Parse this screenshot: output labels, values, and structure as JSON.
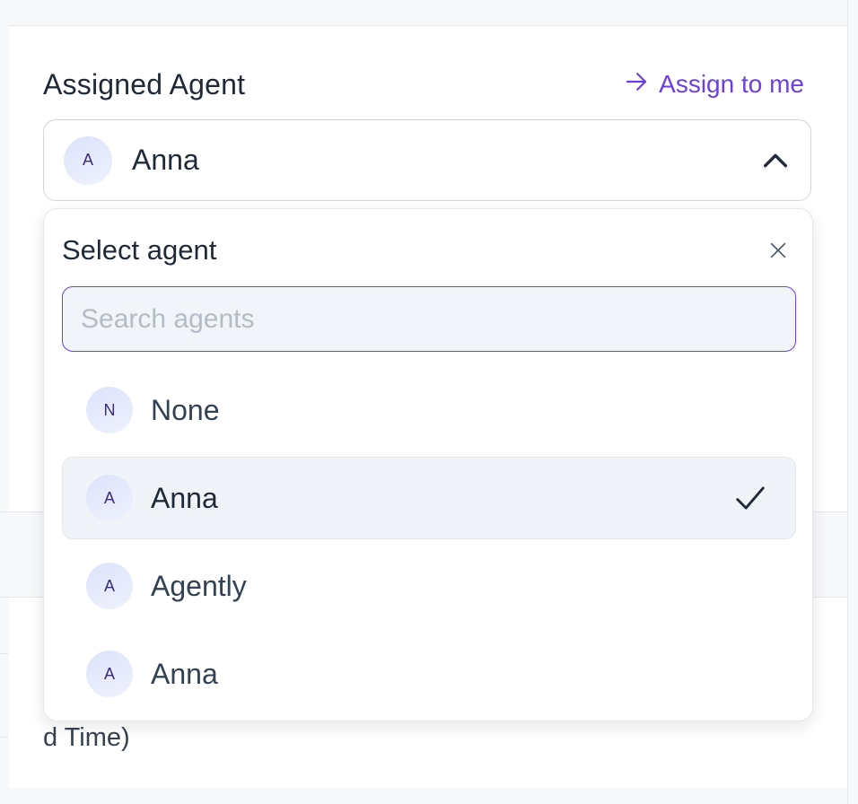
{
  "panel": {
    "title": "Assigned Agent",
    "assign_to_me_label": "Assign to me",
    "selected_agent": {
      "initial": "A",
      "name": "Anna"
    },
    "background_text": "d Time)"
  },
  "dropdown": {
    "title": "Select agent",
    "search_placeholder": "Search agents",
    "search_value": "",
    "items": [
      {
        "initial": "N",
        "name": "None",
        "selected": false
      },
      {
        "initial": "A",
        "name": "Anna",
        "selected": true
      },
      {
        "initial": "A",
        "name": "Agently",
        "selected": false
      },
      {
        "initial": "A",
        "name": "Anna",
        "selected": false
      }
    ]
  },
  "colors": {
    "accent": "#6d3fe0",
    "selected_bg": "#f0f3f7",
    "avatar_text": "#3b2d7a"
  },
  "icons": {
    "assign": "arrow-right-icon",
    "toggle": "chevron-up-icon",
    "close": "close-icon",
    "selected": "check-icon"
  }
}
